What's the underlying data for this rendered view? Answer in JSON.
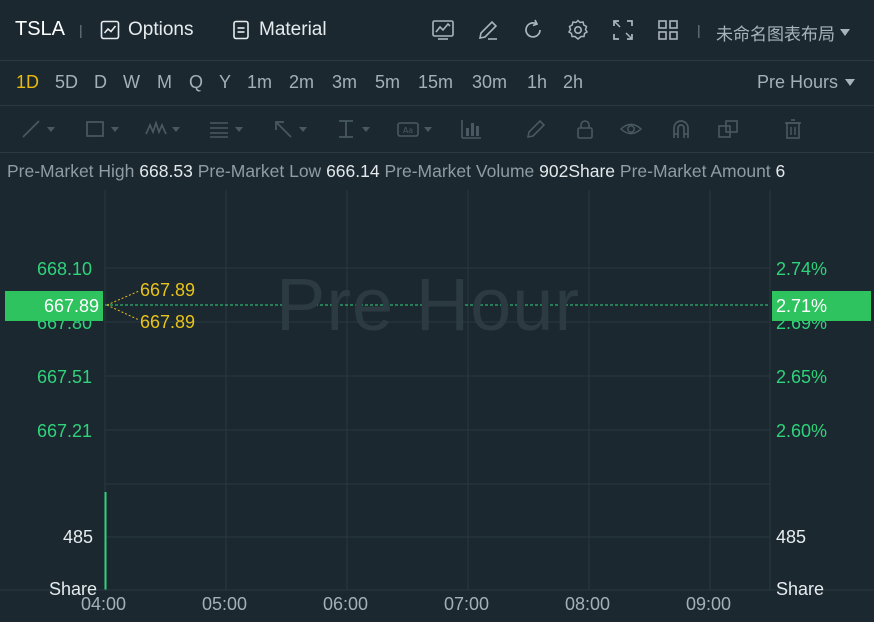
{
  "header": {
    "symbol": "TSLA",
    "options_label": "Options",
    "material_label": "Material",
    "layout_name": "未命名图表布局"
  },
  "periods": [
    "1D",
    "5D",
    "D",
    "W",
    "M",
    "Q",
    "Y",
    "1m",
    "2m",
    "3m",
    "5m",
    "15m",
    "30m",
    "1h",
    "2h"
  ],
  "active_period": "1D",
  "session_selector": "Pre Hours",
  "info": {
    "high_label": "Pre-Market High",
    "high_value": "668.53",
    "low_label": "Pre-Market Low",
    "low_value": "666.14",
    "volume_label": "Pre-Market Volume",
    "volume_value": "902Share",
    "amount_label": "Pre-Market Amount",
    "amount_value": "6"
  },
  "chart": {
    "watermark": "Pre Hour",
    "price_ticks": [
      "668.10",
      "667.80",
      "667.51",
      "667.21"
    ],
    "pct_ticks": [
      "2.74%",
      "2.69%",
      "2.65%",
      "2.60%"
    ],
    "current_price": "667.89",
    "current_pct": "2.71%",
    "marker_top": "667.89",
    "marker_bottom": "667.89",
    "volume_tick": "485",
    "volume_unit": "Share",
    "time_ticks": [
      "04:00",
      "05:00",
      "06:00",
      "07:00",
      "08:00",
      "09:00"
    ],
    "colors": {
      "up": "#2fd37a",
      "tag": "#2fc35f",
      "marker": "#e9c21a",
      "active": "#e8b80c"
    }
  }
}
